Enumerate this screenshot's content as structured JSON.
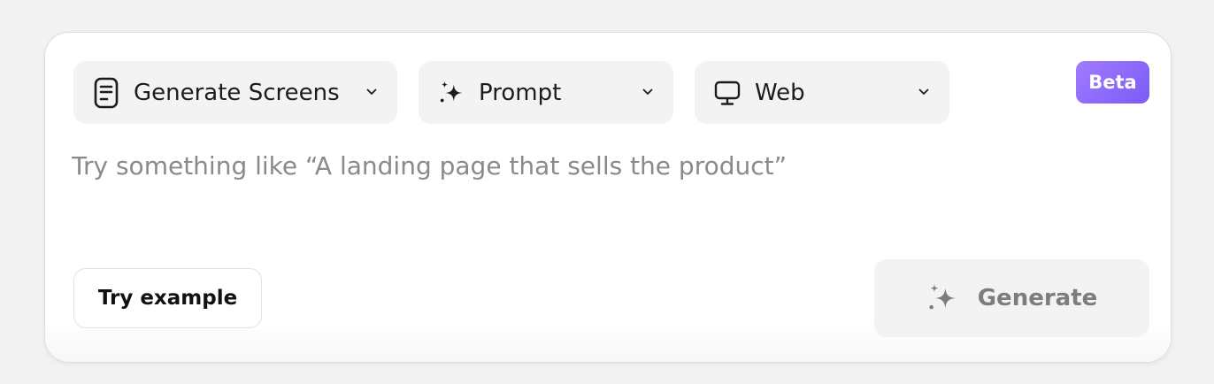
{
  "toolbar": {
    "mode": {
      "label": "Generate Screens",
      "icon": "document-icon"
    },
    "input_type": {
      "label": "Prompt",
      "icon": "sparkle-icon"
    },
    "platform": {
      "label": "Web",
      "icon": "monitor-icon"
    }
  },
  "badge": {
    "label": "Beta"
  },
  "prompt": {
    "value": "",
    "placeholder": "Try something like “A landing page that sells the product”"
  },
  "actions": {
    "try_example_label": "Try example",
    "generate_label": "Generate",
    "generate_icon": "sparkle-icon"
  },
  "colors": {
    "background": "#f2f2f2",
    "card": "#ffffff",
    "control": "#f3f3f3",
    "beta_start": "#a27bff",
    "beta_end": "#7a5bf6"
  }
}
